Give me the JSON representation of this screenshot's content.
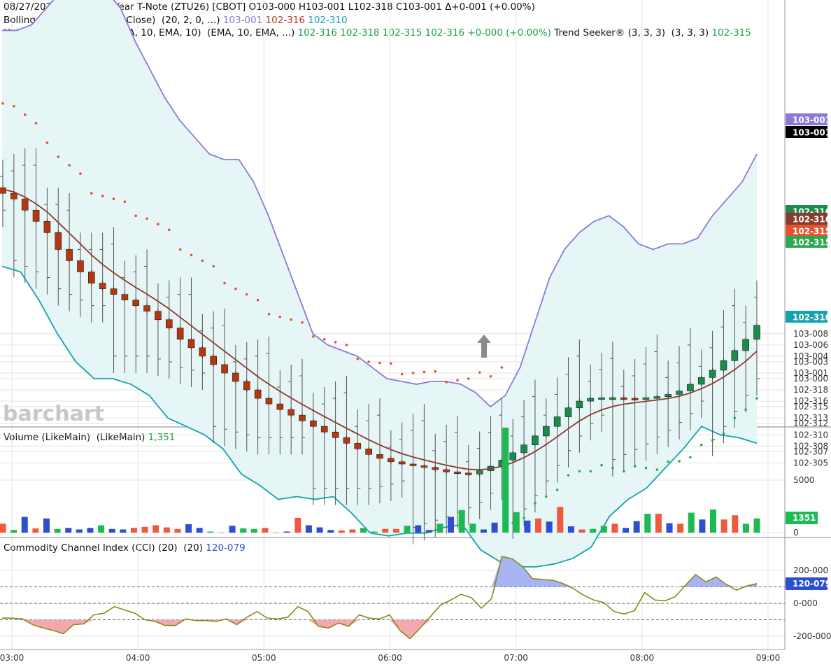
{
  "header": {
    "line1": "08/27/2026  8:55 AM 2-Year T-Note (ZTU26) [CBOT] O103-000 H103-001 L102-318 C103-001 Δ+0-001 (+0.00%)",
    "bb_label": "Bollinger Bands (20, 2, 0, Close)  (20, 2, 0, ...) ",
    "bb_upper": "103-001",
    "bb_mid": "102-316",
    "bb_lower": "102-310",
    "ha_label": "Heikin-Ashi Smoothed (EMA, 10, EMA, 10)  (EMA, 10, EMA, ...) ",
    "ha_values": "102-316 102-318 102-315 102-316 +0-000 (+0.00%)",
    "ts_label": " Trend Seeker® (3, 3, 3)  (3, 3, 3) ",
    "ts_value": "102-315"
  },
  "volume_panel": {
    "label": "Volume (LikeMain)  (LikeMain) ",
    "value": "1,351"
  },
  "cci_panel": {
    "label": "Commodity Channel Index (CCI) (20)  (20) ",
    "value": "120-079"
  },
  "watermark": "barchart",
  "colors": {
    "up": "#1b8a4a",
    "down": "#b5360f",
    "bb_upper": "#8d79d6",
    "bb_lower": "#13a3ac",
    "bb_fill": "#e6f5f5",
    "ma": "#8b3a2e",
    "trend_up": "#2aa84f",
    "trend_down": "#e4522f",
    "vol_up": "#1db954",
    "vol_down": "#ef5a3c",
    "vol_blue": "#2c4fcf",
    "cci_line": "#8a8a1a"
  },
  "price_tags": [
    {
      "text": "103-001",
      "color": "#8d79d6"
    },
    {
      "text": "103-001",
      "color": "#000000"
    },
    {
      "text": "102-316",
      "color": "#1b8a4a"
    },
    {
      "text": "102-316",
      "color": "#8b3a2e"
    },
    {
      "text": "102-315",
      "color": "#e4522f"
    },
    {
      "text": "102-315",
      "color": "#2aa84f"
    },
    {
      "text": "102-310",
      "color": "#13a3ac"
    }
  ],
  "volume_tag": "1351",
  "cci_tag": "120-079",
  "chart_data": [
    {
      "type": "candlestick",
      "panel": "price",
      "title": "2-Year T-Note (ZTU26) [CBOT]",
      "x_ticks": [
        "03:00",
        "04:00",
        "05:00",
        "06:00",
        "07:00",
        "08:00",
        "09:00"
      ],
      "y_ticks": [
        "102-305",
        "102-307",
        "102-308",
        "102-310",
        "102-312",
        "102-313",
        "102-315",
        "102-316",
        "102-318",
        "103-000",
        "103-001",
        "103-003",
        "103-004",
        "103-006",
        "103-008"
      ],
      "y_unit": "32nds above 102 (102-305 = 30.5)",
      "y_range": [
        30.0,
        41.0
      ],
      "heikin_ashi_smoothed": {
        "open": [
          35.4,
          35.3,
          35.2,
          35.0,
          34.8,
          34.6,
          34.3,
          34.1,
          33.9,
          33.7,
          33.6,
          33.5,
          33.4,
          33.3,
          33.2,
          33.05,
          32.9,
          32.7,
          32.55,
          32.4,
          32.25,
          32.1,
          31.95,
          31.8,
          31.65,
          31.55,
          31.45,
          31.35,
          31.25,
          31.15,
          31.05,
          30.95,
          30.85,
          30.75,
          30.65,
          30.58,
          30.52,
          30.48,
          30.45,
          30.42,
          30.38,
          30.34,
          30.32,
          30.3,
          30.36,
          30.44,
          30.55,
          30.68,
          30.82,
          30.98,
          31.15,
          31.32,
          31.48,
          31.6,
          31.65,
          31.66,
          31.66,
          31.65,
          31.64,
          31.66,
          31.68,
          31.72,
          31.78,
          31.9,
          32.02,
          32.15,
          32.32,
          32.5,
          32.7
        ],
        "close": [
          35.3,
          35.2,
          35.0,
          34.8,
          34.6,
          34.3,
          34.1,
          33.9,
          33.7,
          33.6,
          33.5,
          33.4,
          33.3,
          33.2,
          33.05,
          32.9,
          32.7,
          32.55,
          32.4,
          32.25,
          32.1,
          31.95,
          31.8,
          31.65,
          31.55,
          31.45,
          31.35,
          31.25,
          31.15,
          31.05,
          30.95,
          30.85,
          30.75,
          30.65,
          30.58,
          30.52,
          30.48,
          30.45,
          30.42,
          30.38,
          30.34,
          30.32,
          30.3,
          30.36,
          30.44,
          30.55,
          30.68,
          30.82,
          30.98,
          31.15,
          31.32,
          31.48,
          31.6,
          31.65,
          31.66,
          31.66,
          31.65,
          31.64,
          31.66,
          31.68,
          31.72,
          31.78,
          31.9,
          32.02,
          32.15,
          32.32,
          32.5,
          32.7,
          32.95
        ]
      },
      "bollinger": {
        "upper": [
          38.2,
          38.2,
          38.3,
          38.6,
          38.9,
          39.0,
          39.0,
          38.9,
          38.6,
          38.0,
          37.5,
          37.0,
          36.6,
          36.3,
          36.0,
          35.9,
          35.9,
          35.5,
          34.9,
          34.2,
          33.5,
          32.8,
          32.6,
          32.5,
          32.4,
          32.2,
          32.0,
          31.95,
          31.9,
          31.95,
          31.95,
          31.9,
          31.75,
          31.5,
          31.7,
          32.2,
          33.0,
          33.8,
          34.3,
          34.6,
          34.8,
          34.9,
          34.7,
          34.4,
          34.3,
          34.4,
          34.4,
          34.5,
          34.9,
          35.2,
          35.5,
          36.0
        ],
        "lower": [
          34.0,
          33.9,
          33.4,
          32.8,
          32.3,
          32.0,
          32.0,
          31.9,
          31.7,
          31.3,
          31.15,
          31.0,
          30.75,
          30.3,
          30.1,
          29.85,
          29.9,
          29.85,
          29.9,
          29.6,
          29.25,
          29.2,
          29.25,
          29.25,
          29.35,
          29.4,
          28.95,
          28.75,
          28.65,
          28.65,
          28.7,
          28.8,
          29.0,
          29.55,
          29.85,
          30.05,
          30.4,
          30.75,
          31.15,
          31.0,
          30.95,
          30.85
        ],
        "middle_line": "smoothed moving average follows Heikin-Ashi close"
      },
      "trend_seeker": {
        "down_phase_from": "03:00",
        "down_phase_to": "06:45",
        "up_phase_from": "06:45",
        "up_phase_to": "08:55"
      }
    },
    {
      "type": "bar",
      "panel": "volume",
      "title": "Volume (LikeMain)",
      "y_ticks": [
        "0",
        "5000"
      ],
      "y_range": [
        0,
        10000
      ],
      "values": [
        850,
        250,
        1500,
        400,
        1350,
        350,
        450,
        300,
        450,
        700,
        350,
        300,
        450,
        550,
        700,
        500,
        350,
        800,
        450,
        100,
        0,
        650,
        400,
        350,
        450,
        0,
        100,
        1400,
        700,
        500,
        250,
        200,
        300,
        450,
        100,
        350,
        350,
        650,
        700,
        250,
        850,
        1500,
        2150,
        850,
        300,
        950,
        10000,
        1950,
        1150,
        1350,
        1050,
        2450,
        600,
        300,
        350,
        650,
        850,
        450,
        1100,
        1800,
        1800,
        900,
        850,
        1900,
        1250,
        2200,
        1250,
        1650,
        850,
        1351
      ],
      "colors": [
        "red",
        "green",
        "blue",
        "red",
        "blue",
        "green",
        "blue",
        "blue",
        "blue",
        "green",
        "blue",
        "blue",
        "red",
        "red",
        "red",
        "red",
        "red",
        "blue",
        "blue",
        "green",
        "green",
        "blue",
        "green",
        "green",
        "red",
        "green",
        "blue",
        "red",
        "blue",
        "blue",
        "blue",
        "red",
        "red",
        "green",
        "green",
        "red",
        "red",
        "green",
        "blue",
        "blue",
        "green",
        "blue",
        "green",
        "green",
        "blue",
        "blue",
        "green",
        "green",
        "blue",
        "red",
        "blue",
        "red",
        "blue",
        "red",
        "green",
        "green",
        "red",
        "blue",
        "blue",
        "green",
        "red",
        "blue",
        "red",
        "green",
        "blue",
        "green",
        "red",
        "red",
        "green",
        "green"
      ]
    },
    {
      "type": "line",
      "panel": "cci",
      "title": "Commodity Channel Index (CCI) (20)",
      "y_ticks": [
        "200-000",
        "0-000",
        "-200-000"
      ],
      "y_range": [
        -260,
        330
      ],
      "reference_lines": [
        100,
        0,
        -100
      ],
      "values": [
        -90,
        -90,
        -95,
        -130,
        -150,
        -165,
        -185,
        -130,
        -125,
        -70,
        -60,
        -20,
        -40,
        -60,
        -100,
        -110,
        -135,
        -135,
        -95,
        -105,
        -105,
        -110,
        -95,
        -130,
        -85,
        -50,
        -90,
        -95,
        -85,
        -20,
        -50,
        -140,
        -150,
        -120,
        -140,
        -70,
        -90,
        -95,
        -70,
        -165,
        -215,
        -150,
        -80,
        -10,
        20,
        55,
        35,
        -30,
        30,
        285,
        270,
        225,
        150,
        145,
        140,
        120,
        90,
        50,
        20,
        5,
        -50,
        -65,
        -45,
        65,
        20,
        15,
        40,
        110,
        175,
        130,
        160,
        115,
        80,
        105,
        120
      ]
    }
  ]
}
